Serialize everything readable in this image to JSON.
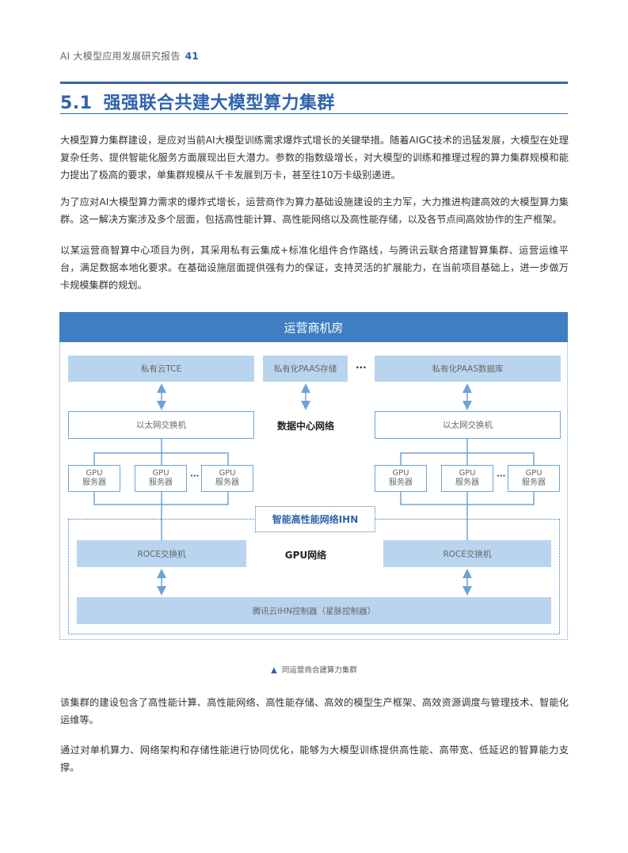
{
  "header": {
    "report_title": "AI 大模型应用发展研究报告",
    "page_number": "41"
  },
  "section": {
    "number": "5.1",
    "title": "强强联合共建大模型算力集群"
  },
  "paragraphs": [
    "大模型算力集群建设，是应对当前AI大模型训练需求爆炸式增长的关键举措。随着AIGC技术的迅猛发展，大模型在处理复杂任务、提供智能化服务方面展现出巨大潜力。参数的指数级增长，对大模型的训练和推理过程的算力集群规模和能力提出了极高的要求，单集群规模从千卡发展到万卡，甚至往10万卡级别递进。",
    "为了应对AI大模型算力需求的爆炸式增长，运营商作为算力基础设施建设的主力军，大力推进构建高效的大模型算力集群。这一解决方案涉及多个层面，包括高性能计算、高性能网络以及高性能存储，以及各节点间高效协作的生产框架。",
    "以某运营商智算中心项目为例，其采用私有云集成+标准化组件合作路线，与腾讯云联合搭建智算集群、运营运维平台，满足数据本地化要求。在基础设施层面提供强有力的保证，支持灵活的扩展能力，在当前项目基础上，进一步做万卡规模集群的规划。"
  ],
  "diagram": {
    "title": "运营商机房",
    "top_row": [
      "私有云TCE",
      "私有化PAAS存储",
      "私有化PAAS数据库"
    ],
    "ellipsis": "···",
    "ethernet_switch": "以太网交换机",
    "datacenter_network_label": "数据中心网络",
    "gpu_server_line1": "GPU",
    "gpu_server_line2": "服务器",
    "gpu_ellipsis": "···",
    "ihn_label": "智能高性能网络IHN",
    "roce_switch": "ROCE交换机",
    "gpu_network_label": "GPU网络",
    "controller": "腾讯云IHN控制器（星脉控制器）",
    "colors": {
      "header_blue": "#3f7ec3",
      "box_fill": "#b9d4ee",
      "line_blue": "#6ea3d6",
      "accent_blue": "#2f63ad"
    }
  },
  "caption": {
    "icon": "▲",
    "text": "同运营商合建算力集群"
  },
  "paragraphs_after": [
    "该集群的建设包含了高性能计算、高性能网络、高性能存储、高效的模型生产框架、高效资源调度与管理技术、智能化运维等。",
    "通过对单机算力、网络架构和存储性能进行协同优化，能够为大模型训练提供高性能、高带宽、低延迟的智算能力支撑。"
  ]
}
